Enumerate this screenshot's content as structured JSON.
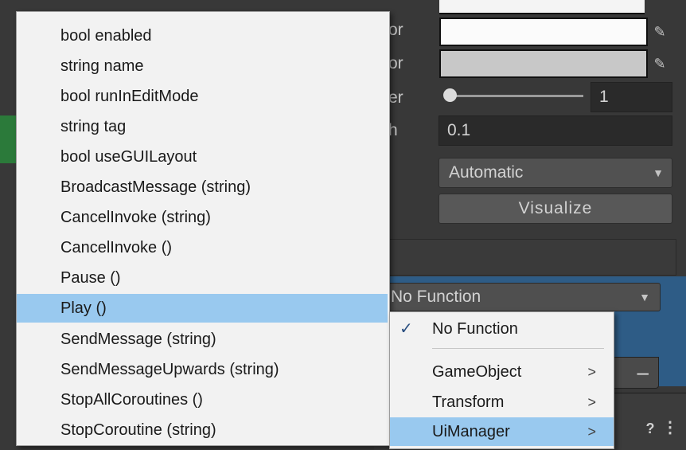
{
  "inspector": {
    "partial_labels": [
      "or",
      "or",
      "er",
      "h"
    ],
    "slider_value": "1",
    "numeric_field_value": "0.1",
    "dropdown_value": "Automatic",
    "visualize_button_label": "Visualize",
    "function_dropdown_value": "No Function",
    "minus_button_label": "–",
    "help_icon_glyph": "?",
    "more_icon_glyph": "⋮"
  },
  "menu": {
    "items": [
      "bool enabled",
      "string name",
      "bool runInEditMode",
      "string tag",
      "bool useGUILayout",
      "BroadcastMessage (string)",
      "CancelInvoke (string)",
      "CancelInvoke ()",
      "Pause ()",
      "Play ()",
      "SendMessage (string)",
      "SendMessageUpwards (string)",
      "StopAllCoroutines ()",
      "StopCoroutine (string)"
    ],
    "selected_item": "Play ()"
  },
  "submenu": {
    "items": [
      {
        "label": "No Function",
        "checked": true,
        "has_submenu": false
      },
      {
        "label": "GameObject",
        "checked": false,
        "has_submenu": true
      },
      {
        "label": "Transform",
        "checked": false,
        "has_submenu": true
      },
      {
        "label": "UiManager",
        "checked": false,
        "has_submenu": true
      }
    ],
    "check_glyph": "✓",
    "chevron_glyph": ">",
    "selected_item": "UiManager"
  },
  "colors": {
    "menu_background": "#f2f2f2",
    "menu_highlight": "#99c9ef",
    "inspector_background": "#383838",
    "event_panel": "#2e5c86"
  }
}
